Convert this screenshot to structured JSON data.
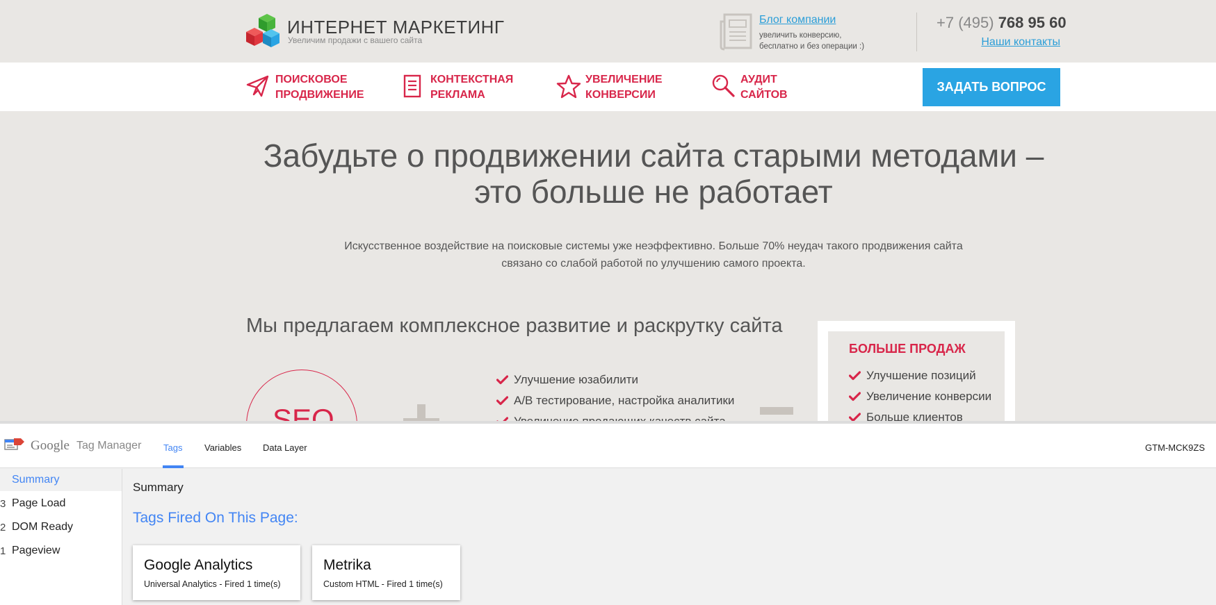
{
  "site": {
    "logo_title": "ИНТЕРНЕТ МАРКЕТИНГ",
    "logo_subtitle": "Увеличим продажи с вашего сайта",
    "blog": {
      "link": "Блог компании",
      "note_line1": "увеличить конверсию,",
      "note_line2": "бесплатно и без операции :)"
    },
    "phone_prefix": "+7 (495)",
    "phone_number": "768 95 60",
    "contacts_link": "Наши контакты",
    "nav": [
      {
        "line1": "Поисковое",
        "line2": "продвижение",
        "icon": "paper-plane-icon"
      },
      {
        "line1": "Контекстная",
        "line2": "реклама",
        "icon": "document-icon"
      },
      {
        "line1": "Увеличение",
        "line2": "конверсии",
        "icon": "star-icon"
      },
      {
        "line1": "Аудит",
        "line2": "сайтов",
        "icon": "magnifier-icon"
      }
    ],
    "ask_button": "ЗАДАТЬ ВОПРОС",
    "hero_title_line1": "Забудьте о продвижении сайта старыми методами –",
    "hero_title_line2": "это больше не работает",
    "hero_text_line1": "Искусственное воздействие на поисковые системы уже неэффективно. Больше 70% неудач такого продвижения сайта",
    "hero_text_line2": "связано со слабой работой по улучшению самого проекта.",
    "offer_title": "Мы предлагаем комплексное развитие и раскрутку сайта",
    "seo_label": "SEO",
    "checklist": [
      "Улучшение юзабилити",
      "A/B тестирование, настройка аналитики",
      "Увеличение продающих качеств сайта"
    ],
    "box_title": "БОЛЬШЕ ПРОДАЖ",
    "box_list": [
      "Улучшение позиций",
      "Увеличение конверсии",
      "Больше клиентов"
    ],
    "colors": {
      "accent_red": "#d8264a",
      "accent_blue": "#2aa4e3",
      "background": "#e9e7e4"
    }
  },
  "gtm": {
    "brand_google": "Google",
    "brand_product": "Tag Manager",
    "tabs": [
      "Tags",
      "Variables",
      "Data Layer"
    ],
    "active_tab": "Tags",
    "container_id": "GTM-MCK9ZS",
    "sidebar": [
      {
        "num": "",
        "label": "Summary"
      },
      {
        "num": "3",
        "label": "Page Load"
      },
      {
        "num": "2",
        "label": "DOM Ready"
      },
      {
        "num": "1",
        "label": "Pageview"
      }
    ],
    "summary_title": "Summary",
    "fired_title": "Tags Fired On This Page:",
    "cards": [
      {
        "name": "Google Analytics",
        "detail": "Universal Analytics - Fired 1 time(s)"
      },
      {
        "name": "Metrika",
        "detail": "Custom HTML - Fired 1 time(s)"
      }
    ],
    "colors": {
      "accent_blue": "#4285f4"
    }
  }
}
